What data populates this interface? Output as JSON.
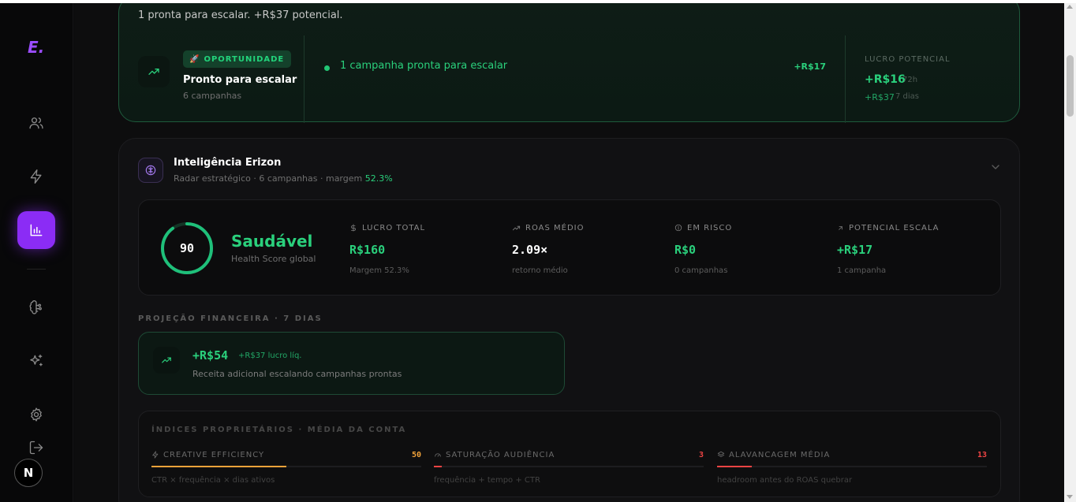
{
  "app": {
    "logo": "E.",
    "avatar_initial": "N"
  },
  "sidebar": {
    "items": [
      {
        "name": "users",
        "active": false
      },
      {
        "name": "zap",
        "active": false
      },
      {
        "name": "chart",
        "active": true
      },
      {
        "name": "brain",
        "active": false
      },
      {
        "name": "sparkles",
        "active": false
      },
      {
        "name": "settings",
        "active": false
      },
      {
        "name": "logout",
        "active": false
      }
    ]
  },
  "opportunity": {
    "summary": "1 pronta para escalar. +R$37 potencial.",
    "badge": "OPORTUNIDADE",
    "title": "Pronto para escalar",
    "subtitle": "6 campanhas",
    "item_text": "1 campanha pronta para escalar",
    "item_value": "+R$17",
    "potential_label": "LUCRO POTENCIAL",
    "potential_value": "+R$16",
    "potential_period": "72h",
    "potential_secondary": "+R$37",
    "potential_secondary_period": "7 dias"
  },
  "intelligence": {
    "title": "Inteligência Erizon",
    "subtitle_prefix": "Radar estratégico · 6 campanhas · margem",
    "margin": "52.3%",
    "health_score": 90,
    "health_status": "Saudável",
    "health_label": "Health Score global",
    "kpis": [
      {
        "label": "LUCRO TOTAL",
        "icon": "dollar-icon",
        "value": "R$160",
        "sub": "Margem 52.3%",
        "color": "green"
      },
      {
        "label": "ROAS MÉDIO",
        "icon": "trend-up-icon",
        "value": "2.09×",
        "sub": "retorno médio",
        "color": "white"
      },
      {
        "label": "EM RISCO",
        "icon": "alert-circle-icon",
        "value": "R$0",
        "sub": "0 campanhas",
        "color": "green"
      },
      {
        "label": "POTENCIAL ESCALA",
        "icon": "arrow-up-right-icon",
        "value": "+R$17",
        "sub": "1 campanha",
        "color": "green"
      }
    ],
    "projection_label": "PROJEÇÃO FINANCEIRA · 7 DIAS",
    "projection_value": "+R$54",
    "projection_sub": "+R$37 lucro líq.",
    "projection_desc": "Receita adicional escalando campanhas prontas",
    "indices_label": "ÍNDICES PROPRIETÁRIOS · MÉDIA DA CONTA",
    "indices": [
      {
        "name": "CREATIVE EFFICIENCY",
        "icon": "zap-icon",
        "value": 50,
        "desc": "CTR × frequência × dias ativos",
        "color": "#f0a23a"
      },
      {
        "name": "SATURAÇÃO AUDIÊNCIA",
        "icon": "gauge-icon",
        "value": 3,
        "desc": "frequência + tempo + CTR",
        "color": "#ef4444"
      },
      {
        "name": "ALAVANCAGEM MÉDIA",
        "icon": "layers-icon",
        "value": 13,
        "desc": "headroom antes do ROAS quebrar",
        "color": "#ef4444"
      }
    ]
  }
}
